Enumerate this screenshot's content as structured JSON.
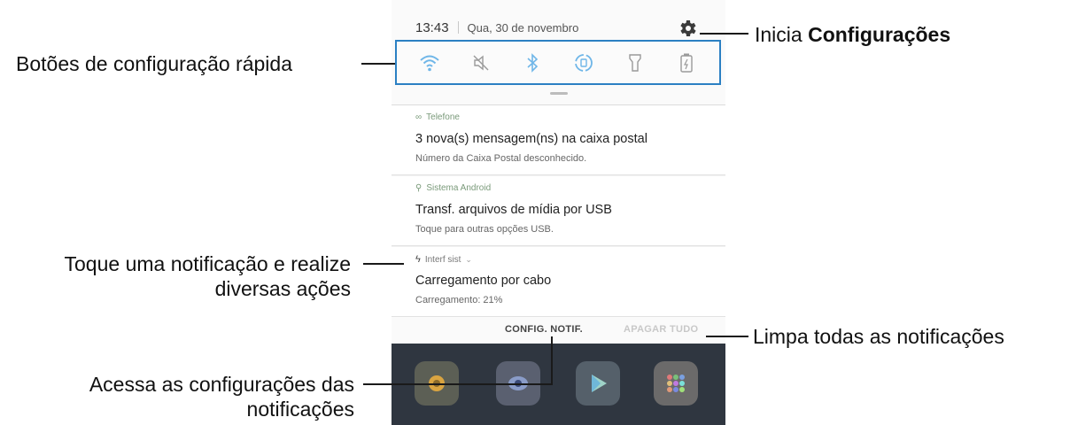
{
  "status_bar": {
    "time": "13:43",
    "date": "Qua, 30 de novembro"
  },
  "quick_settings": [
    "wifi-icon",
    "sound-off-icon",
    "bluetooth-icon",
    "auto-rotate-icon",
    "flashlight-icon",
    "power-saving-icon"
  ],
  "notifications": [
    {
      "app": "Telefone",
      "title": "3 nova(s) mensagem(ns) na caixa postal",
      "text": "Número da Caixa Postal desconhecido."
    },
    {
      "app": "Sistema Android",
      "title": "Transf. arquivos de mídia por USB",
      "text": "Toque para outras opções USB."
    },
    {
      "app": "Interf sist",
      "title": "Carregamento por cabo",
      "text": "Carregamento: 21%"
    }
  ],
  "actions": {
    "config_label": "CONFIG. NOTIF.",
    "clear_label": "APAGAR TUDO"
  },
  "callouts": {
    "quick_buttons": "Botões de configuração rápida",
    "settings_prefix": "Inicia ",
    "settings_bold": "Configurações",
    "tap_notification_line1": "Toque uma notificação e realize",
    "tap_notification_line2": "diversas ações",
    "clear_all": "Limpa todas as notificações",
    "access_settings_line1": "Acessa as configurações das",
    "access_settings_line2": "notificações"
  },
  "colors": {
    "accent": "#2b80c3",
    "home_background": "#2f3640"
  }
}
